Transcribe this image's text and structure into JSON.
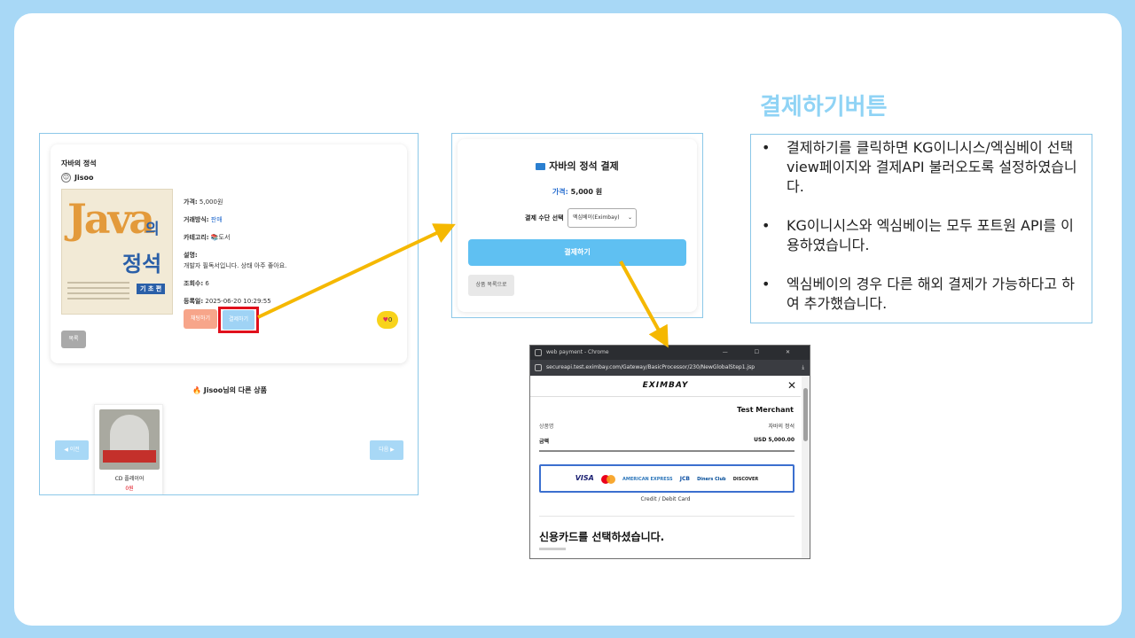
{
  "slide": {
    "title": "결제하기버튼",
    "bullets": [
      "결제하기를 클릭하면 KG이니시스/엑심베이 선택 view페이지와 결제API 불러오도록 설정하였습니다.",
      "KG이니시스와 엑심베이는 모두 포트원 API를 이용하였습니다.",
      "엑심베이의 경우 다른 해외 결제가 가능하다고 하여 추가했습니다."
    ],
    "highlight_color": "#e0101c",
    "arrow_color": "#f5b800"
  },
  "product_page": {
    "title": "자바의 정석",
    "seller": "Jisoo",
    "book_cover": {
      "logo_text": "Java",
      "logo_suffix": "의",
      "subtitle": "정석",
      "edition": "기 초 편"
    },
    "price_label": "가격:",
    "price_value": "5,000원",
    "deal_label": "거래방식:",
    "deal_value": "판매",
    "category_label": "카테고리:",
    "category_value": "📚도서",
    "desc_label": "설명:",
    "desc_value": "개발자 필독서입니다. 상태 아주 좋아요.",
    "views_label": "조회수:",
    "views_value": "6",
    "date_label": "등록일:",
    "date_value": "2025-06-20 10:29:55",
    "chat_button": "채팅하기",
    "pay_button": "결제하기",
    "like_count": "0",
    "list_button": "목록",
    "others_title": "🔥 Jisoo님의 다른 상품",
    "other_item": {
      "name": "CD 플레이어",
      "price": "0원"
    },
    "prev_button": "◀ 이전",
    "next_button": "다음 ▶"
  },
  "payment_page": {
    "title": "자바의 정석 결제",
    "price_label": "가격:",
    "price_value": "5,000 원",
    "method_label": "결제 수단 선택",
    "method_selected": "엑심베이(Eximbay)",
    "pay_button": "결제하기",
    "back_button": "상품 목록으로"
  },
  "eximbay_window": {
    "window_title": "web payment - Chrome",
    "window_controls": "— ☐ ✕",
    "url": "secureapi.test.eximbay.com/Gateway/BasicProcessor/230/NewGlobalStep1.jsp",
    "download_icon": "⤓",
    "logo": "EXIMBAY",
    "close": "✕",
    "merchant": "Test Merchant",
    "product_label": "상품명",
    "product_value": "자바의 정석",
    "amount_label": "금액",
    "amount_value": "USD 5,000.00",
    "card_logos": [
      "VISA",
      "AMERICAN EXPRESS",
      "JCB",
      "Diners Club",
      "DISCOVER"
    ],
    "card_label": "Credit / Debit Card",
    "selected_text": "신용카드를 선택하셨습니다."
  }
}
